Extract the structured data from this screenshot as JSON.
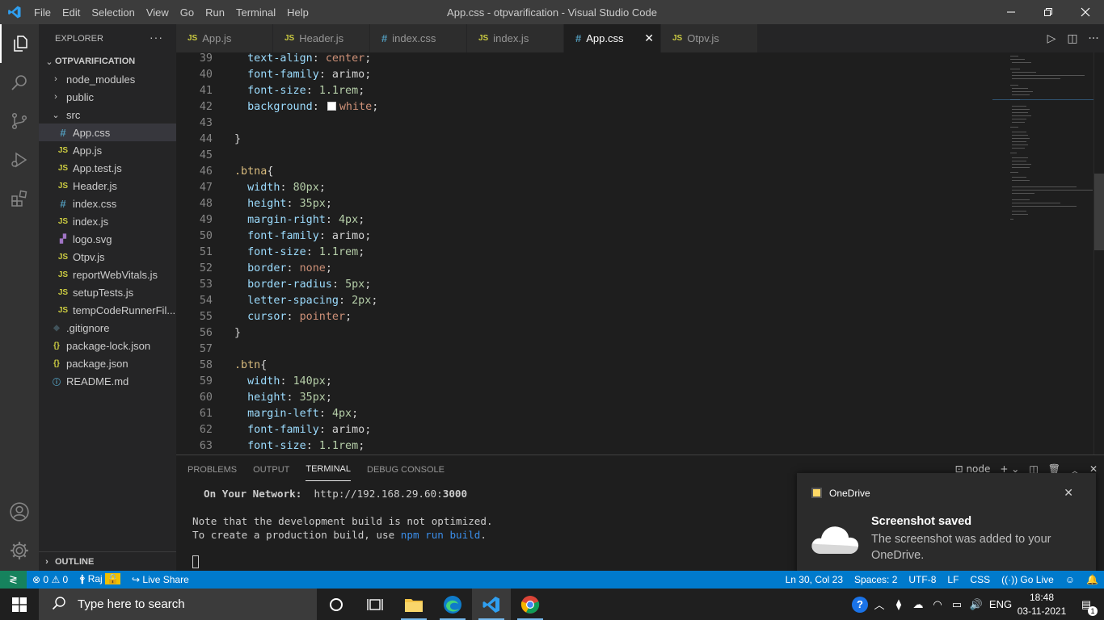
{
  "window": {
    "title": "App.css - otpvarification - Visual Studio Code",
    "menu": [
      "File",
      "Edit",
      "Selection",
      "View",
      "Go",
      "Run",
      "Terminal",
      "Help"
    ]
  },
  "explorer": {
    "header": "EXPLORER",
    "project": "OTPVARIFICATION",
    "items": [
      {
        "label": "node_modules",
        "type": "folder",
        "open": false,
        "depth": 1
      },
      {
        "label": "public",
        "type": "folder",
        "open": false,
        "depth": 1
      },
      {
        "label": "src",
        "type": "folder",
        "open": true,
        "depth": 1
      },
      {
        "label": "App.css",
        "type": "css",
        "depth": 2,
        "selected": true
      },
      {
        "label": "App.js",
        "type": "js",
        "depth": 2
      },
      {
        "label": "App.test.js",
        "type": "js",
        "depth": 2
      },
      {
        "label": "Header.js",
        "type": "js",
        "depth": 2
      },
      {
        "label": "index.css",
        "type": "css",
        "depth": 2
      },
      {
        "label": "index.js",
        "type": "js",
        "depth": 2
      },
      {
        "label": "logo.svg",
        "type": "svg",
        "depth": 2
      },
      {
        "label": "Otpv.js",
        "type": "js",
        "depth": 2
      },
      {
        "label": "reportWebVitals.js",
        "type": "js",
        "depth": 2
      },
      {
        "label": "setupTests.js",
        "type": "js",
        "depth": 2
      },
      {
        "label": "tempCodeRunnerFil...",
        "type": "js",
        "depth": 2
      },
      {
        "label": ".gitignore",
        "type": "git",
        "depth": 1
      },
      {
        "label": "package-lock.json",
        "type": "json",
        "depth": 1
      },
      {
        "label": "package.json",
        "type": "json",
        "depth": 1
      },
      {
        "label": "README.md",
        "type": "info",
        "depth": 1
      }
    ],
    "outline": "OUTLINE"
  },
  "tabs": [
    {
      "label": "App.js",
      "type": "js"
    },
    {
      "label": "Header.js",
      "type": "js"
    },
    {
      "label": "index.css",
      "type": "css"
    },
    {
      "label": "index.js",
      "type": "js"
    },
    {
      "label": "App.css",
      "type": "css",
      "active": true
    },
    {
      "label": "Otpv.js",
      "type": "js"
    }
  ],
  "editor": {
    "lines": [
      {
        "n": 39,
        "tokens": [
          [
            "  ",
            "pun"
          ],
          [
            "text-align",
            "prop"
          ],
          [
            ": ",
            "pun"
          ],
          [
            "center",
            "val"
          ],
          [
            ";",
            "pun"
          ]
        ]
      },
      {
        "n": 40,
        "tokens": [
          [
            "  ",
            "pun"
          ],
          [
            "font-family",
            "prop"
          ],
          [
            ": arimo;",
            "pun"
          ]
        ]
      },
      {
        "n": 41,
        "tokens": [
          [
            "  ",
            "pun"
          ],
          [
            "font-size",
            "prop"
          ],
          [
            ": ",
            "pun"
          ],
          [
            "1.1rem",
            "num"
          ],
          [
            ";",
            "pun"
          ]
        ]
      },
      {
        "n": 42,
        "tokens": [
          [
            "  ",
            "pun"
          ],
          [
            "background",
            "prop"
          ],
          [
            ": ",
            "pun"
          ],
          [
            "",
            "swatch"
          ],
          [
            "white",
            "val"
          ],
          [
            ";",
            "pun"
          ]
        ]
      },
      {
        "n": 43,
        "tokens": []
      },
      {
        "n": 44,
        "tokens": [
          [
            "}",
            "pun"
          ]
        ]
      },
      {
        "n": 45,
        "tokens": []
      },
      {
        "n": 46,
        "tokens": [
          [
            ".btna",
            "sel"
          ],
          [
            "{",
            "pun"
          ]
        ]
      },
      {
        "n": 47,
        "tokens": [
          [
            "  ",
            "pun"
          ],
          [
            "width",
            "prop"
          ],
          [
            ": ",
            "pun"
          ],
          [
            "80px",
            "num"
          ],
          [
            ";",
            "pun"
          ]
        ]
      },
      {
        "n": 48,
        "tokens": [
          [
            "  ",
            "pun"
          ],
          [
            "height",
            "prop"
          ],
          [
            ": ",
            "pun"
          ],
          [
            "35px",
            "num"
          ],
          [
            ";",
            "pun"
          ]
        ]
      },
      {
        "n": 49,
        "tokens": [
          [
            "  ",
            "pun"
          ],
          [
            "margin-right",
            "prop"
          ],
          [
            ": ",
            "pun"
          ],
          [
            "4px",
            "num"
          ],
          [
            ";",
            "pun"
          ]
        ]
      },
      {
        "n": 50,
        "tokens": [
          [
            "  ",
            "pun"
          ],
          [
            "font-family",
            "prop"
          ],
          [
            ": arimo;",
            "pun"
          ]
        ]
      },
      {
        "n": 51,
        "tokens": [
          [
            "  ",
            "pun"
          ],
          [
            "font-size",
            "prop"
          ],
          [
            ": ",
            "pun"
          ],
          [
            "1.1rem",
            "num"
          ],
          [
            ";",
            "pun"
          ]
        ]
      },
      {
        "n": 52,
        "tokens": [
          [
            "  ",
            "pun"
          ],
          [
            "border",
            "prop"
          ],
          [
            ": ",
            "pun"
          ],
          [
            "none",
            "val"
          ],
          [
            ";",
            "pun"
          ]
        ]
      },
      {
        "n": 53,
        "tokens": [
          [
            "  ",
            "pun"
          ],
          [
            "border-radius",
            "prop"
          ],
          [
            ": ",
            "pun"
          ],
          [
            "5px",
            "num"
          ],
          [
            ";",
            "pun"
          ]
        ]
      },
      {
        "n": 54,
        "tokens": [
          [
            "  ",
            "pun"
          ],
          [
            "letter-spacing",
            "prop"
          ],
          [
            ": ",
            "pun"
          ],
          [
            "2px",
            "num"
          ],
          [
            ";",
            "pun"
          ]
        ]
      },
      {
        "n": 55,
        "tokens": [
          [
            "  ",
            "pun"
          ],
          [
            "cursor",
            "prop"
          ],
          [
            ": ",
            "pun"
          ],
          [
            "pointer",
            "val"
          ],
          [
            ";",
            "pun"
          ]
        ]
      },
      {
        "n": 56,
        "tokens": [
          [
            "}",
            "pun"
          ]
        ]
      },
      {
        "n": 57,
        "tokens": []
      },
      {
        "n": 58,
        "tokens": [
          [
            ".btn",
            "sel"
          ],
          [
            "{",
            "pun"
          ]
        ]
      },
      {
        "n": 59,
        "tokens": [
          [
            "  ",
            "pun"
          ],
          [
            "width",
            "prop"
          ],
          [
            ": ",
            "pun"
          ],
          [
            "140px",
            "num"
          ],
          [
            ";",
            "pun"
          ]
        ]
      },
      {
        "n": 60,
        "tokens": [
          [
            "  ",
            "pun"
          ],
          [
            "height",
            "prop"
          ],
          [
            ": ",
            "pun"
          ],
          [
            "35px",
            "num"
          ],
          [
            ";",
            "pun"
          ]
        ]
      },
      {
        "n": 61,
        "tokens": [
          [
            "  ",
            "pun"
          ],
          [
            "margin-left",
            "prop"
          ],
          [
            ": ",
            "pun"
          ],
          [
            "4px",
            "num"
          ],
          [
            ";",
            "pun"
          ]
        ]
      },
      {
        "n": 62,
        "tokens": [
          [
            "  ",
            "pun"
          ],
          [
            "font-family",
            "prop"
          ],
          [
            ": arimo;",
            "pun"
          ]
        ]
      },
      {
        "n": 63,
        "tokens": [
          [
            "  ",
            "pun"
          ],
          [
            "font-size",
            "prop"
          ],
          [
            ": ",
            "pun"
          ],
          [
            "1.1rem",
            "num"
          ],
          [
            ";",
            "pun"
          ]
        ]
      }
    ]
  },
  "panel": {
    "tabs": [
      "PROBLEMS",
      "OUTPUT",
      "TERMINAL",
      "DEBUG CONSOLE"
    ],
    "active_tab": "TERMINAL",
    "terminal_name": "node",
    "network_label": "On Your Network:",
    "network_url_prefix": "http://192.168.29.60:",
    "network_url_port": "3000",
    "note_line": "Note that the development build is not optimized.",
    "prod_prefix": "To create a production build, use ",
    "prod_cmd": "npm run build",
    "prod_suffix": "."
  },
  "notification": {
    "app": "OneDrive",
    "title": "Screenshot saved",
    "body": "The screenshot was added to your OneDrive."
  },
  "statusbar": {
    "errors": "0",
    "warnings": "0",
    "user": "Raj",
    "live_share": "Live Share",
    "position": "Ln 30, Col 23",
    "spaces": "Spaces: 2",
    "encoding": "UTF-8",
    "eol": "LF",
    "language": "CSS",
    "go_live": "Go Live"
  },
  "taskbar": {
    "search_placeholder": "Type here to search",
    "language": "ENG",
    "time": "18:48",
    "date": "03-11-2021",
    "notification_count": "1"
  },
  "colors": {
    "accent": "#007acc",
    "selector": "#d7ba7d",
    "property": "#9cdcfe",
    "string": "#ce9178",
    "number": "#b5cea8",
    "js_icon": "#cbcb41",
    "css_icon": "#519aba"
  }
}
